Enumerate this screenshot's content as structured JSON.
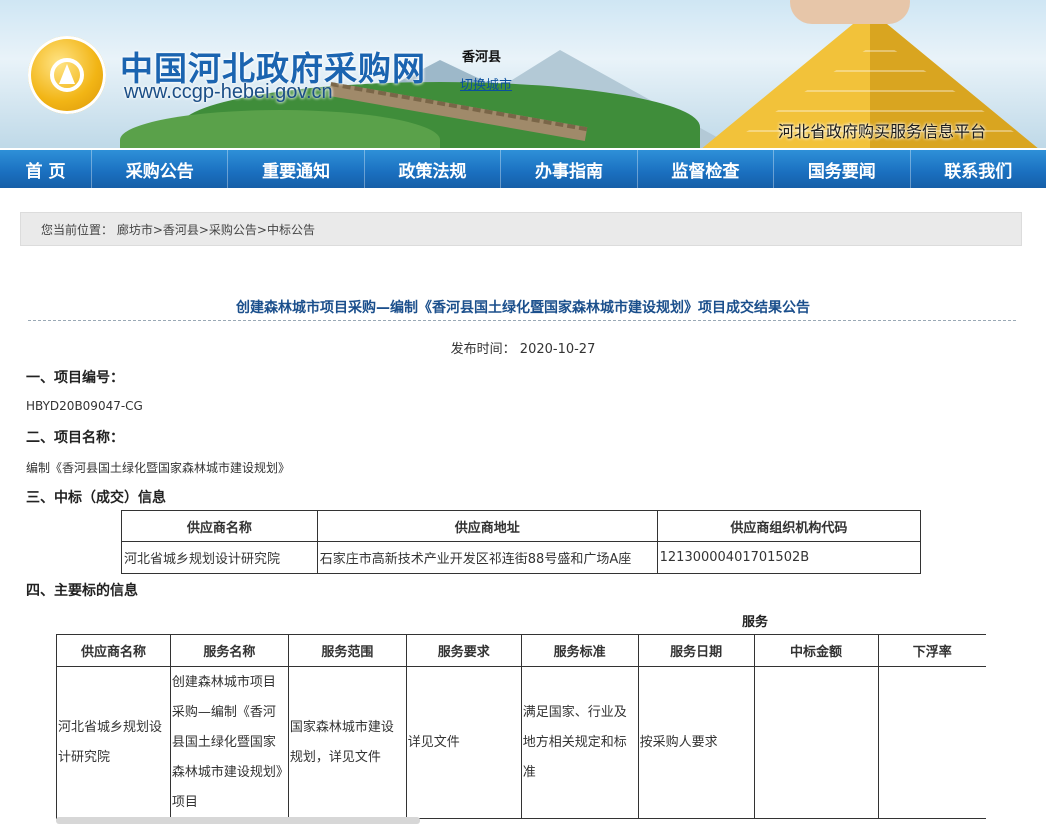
{
  "header": {
    "site_title": "中国河北政府采购网",
    "site_url": "www.ccgp-hebei.gov.cn",
    "county": "香河县",
    "switch_city": "切换城市",
    "platform": "河北省政府购买服务信息平台"
  },
  "nav": {
    "items": [
      "首 页",
      "采购公告",
      "重要通知",
      "政策法规",
      "办事指南",
      "监督检查",
      "国务要闻",
      "联系我们"
    ]
  },
  "breadcrumb": {
    "text": "您当前位置： 廊坊市>香河县>采购公告>中标公告"
  },
  "article": {
    "title": "创建森林城市项目采购—编制《香河县国土绿化暨国家森林城市建设规划》项目成交结果公告",
    "pub_label": "发布时间：",
    "pub_date": "2020-10-27",
    "sec1_label": "一、项目编号：",
    "sec1_value": "HBYD20B09047-CG",
    "sec2_label": "二、项目名称：",
    "sec2_value": "编制《香河县国土绿化暨国家森林城市建设规划》",
    "sec3_label": "三、中标（成交）信息",
    "supplier_table": {
      "headers": [
        "供应商名称",
        "供应商地址",
        "供应商组织机构代码"
      ],
      "row": [
        "河北省城乡规划设计研究院",
        "石家庄市高新技术产业开发区祁连街88号盛和广场A座",
        "12130000401701502B"
      ]
    },
    "sec4_label": "四、主要标的信息",
    "service_label": "服务",
    "service_table": {
      "headers": [
        "供应商名称",
        "服务名称",
        "服务范围",
        "服务要求",
        "服务标准",
        "服务日期",
        "中标金额",
        "下浮率"
      ],
      "row": [
        "河北省城乡规划设计研究院",
        "创建森林城市项目采购—编制《香河县国土绿化暨国家森林城市建设规划》项目",
        "国家森林城市建设规划，详见文件",
        "详见文件",
        "满足国家、行业及地方相关规定和标准",
        "按采购人要求",
        "",
        ""
      ]
    }
  }
}
